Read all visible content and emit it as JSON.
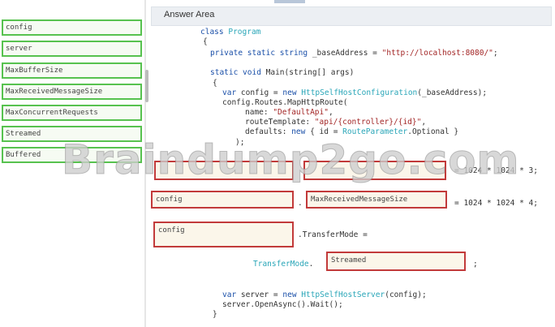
{
  "answer_area": {
    "title": "Answer Area"
  },
  "watermark": "Braindump2go.com",
  "source_items": [
    "config",
    "server",
    "MaxBufferSize",
    "MaxReceivedMessageSize",
    "MaxConcurrentRequests",
    "Streamed",
    "Buffered"
  ],
  "code": {
    "l1_kw": "class",
    "l1_type": "Program",
    "l2": "{",
    "l3_kw": "private static string",
    "l3_mid": " _baseAddress = ",
    "l3_str": "\"http://localhost:8080/\"",
    "l3_end": ";",
    "l4_kw": "static void",
    "l4_rest": " Main(string[] args)",
    "l5": "{",
    "l6_kw": "var",
    "l6_mid1": " config = ",
    "l6_kw2": "new",
    "l6_type": " HttpSelfHostConfiguration",
    "l6_end": "(_baseAddress);",
    "l7": "config.Routes.MapHttpRoute(",
    "l8_pre": "name: ",
    "l8_str": "\"DefaultApi\"",
    "l8_end": ",",
    "l9_pre": "routeTemplate: ",
    "l9_str": "\"api/{controller}/{id}\"",
    "l9_end": ",",
    "l10_pre": "defaults: ",
    "l10_kw": "new",
    "l10_mid": " { id = ",
    "l10_type": "RouteParameter",
    "l10_end": ".Optional }",
    "l11": ");",
    "row1_suffix": "= 1024 * 1024 * 3;",
    "row2_dot": ".",
    "row2_suffix": "= 1024 * 1024 * 4;",
    "row3_suffix": ".TransferMode =",
    "row4_type": "TransferMode",
    "row4_dot": ".",
    "row4_end": ";",
    "l12_kw": "var",
    "l12_mid": " server = ",
    "l12_kw2": "new",
    "l12_type": " HttpSelfHostServer",
    "l12_end": "(config);",
    "l13": "server.OpenAsync().Wait();",
    "l14": "}"
  },
  "drops": {
    "row1_left": "",
    "row1_right": "",
    "row2_left": "config",
    "row2_right": "MaxReceivedMessageSize",
    "row3_left": "config",
    "row4": "Streamed"
  }
}
